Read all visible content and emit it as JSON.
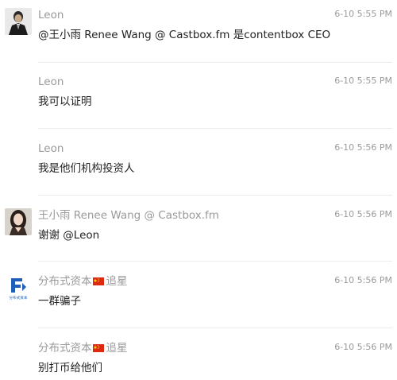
{
  "messages": [
    {
      "sender": "Leon",
      "time": "6-10 5:55 PM",
      "text": "@王小雨 Renee Wang @ Castbox.fm 是contentbox CEO",
      "avatar": "leon-avatar"
    },
    {
      "sender": "Leon",
      "time": "6-10 5:55 PM",
      "text": "我可以证明"
    },
    {
      "sender": "Leon",
      "time": "6-10 5:56 PM",
      "text": "我是他们机构投资人"
    },
    {
      "sender": "王小雨 Renee Wang @ Castbox.fm",
      "time": "6-10 5:56 PM",
      "text": "谢谢 @Leon",
      "avatar": "renee-avatar"
    },
    {
      "sender": "分布式资本",
      "sender_suffix": "追星",
      "time": "6-10 5:56 PM",
      "text": "一群骗子",
      "avatar": "distributed-capital-logo"
    },
    {
      "sender": "分布式资本",
      "sender_suffix": "追星",
      "time": "6-10 5:56 PM",
      "text": "别打币给他们"
    }
  ],
  "logo_text": "分布式资本",
  "colors": {
    "meta_text": "#9a9a9a",
    "body_text": "#222222",
    "divider": "#ececec",
    "logo_blue": "#1f5fb8",
    "flag_red": "#de2910",
    "flag_yellow": "#ffde00"
  }
}
